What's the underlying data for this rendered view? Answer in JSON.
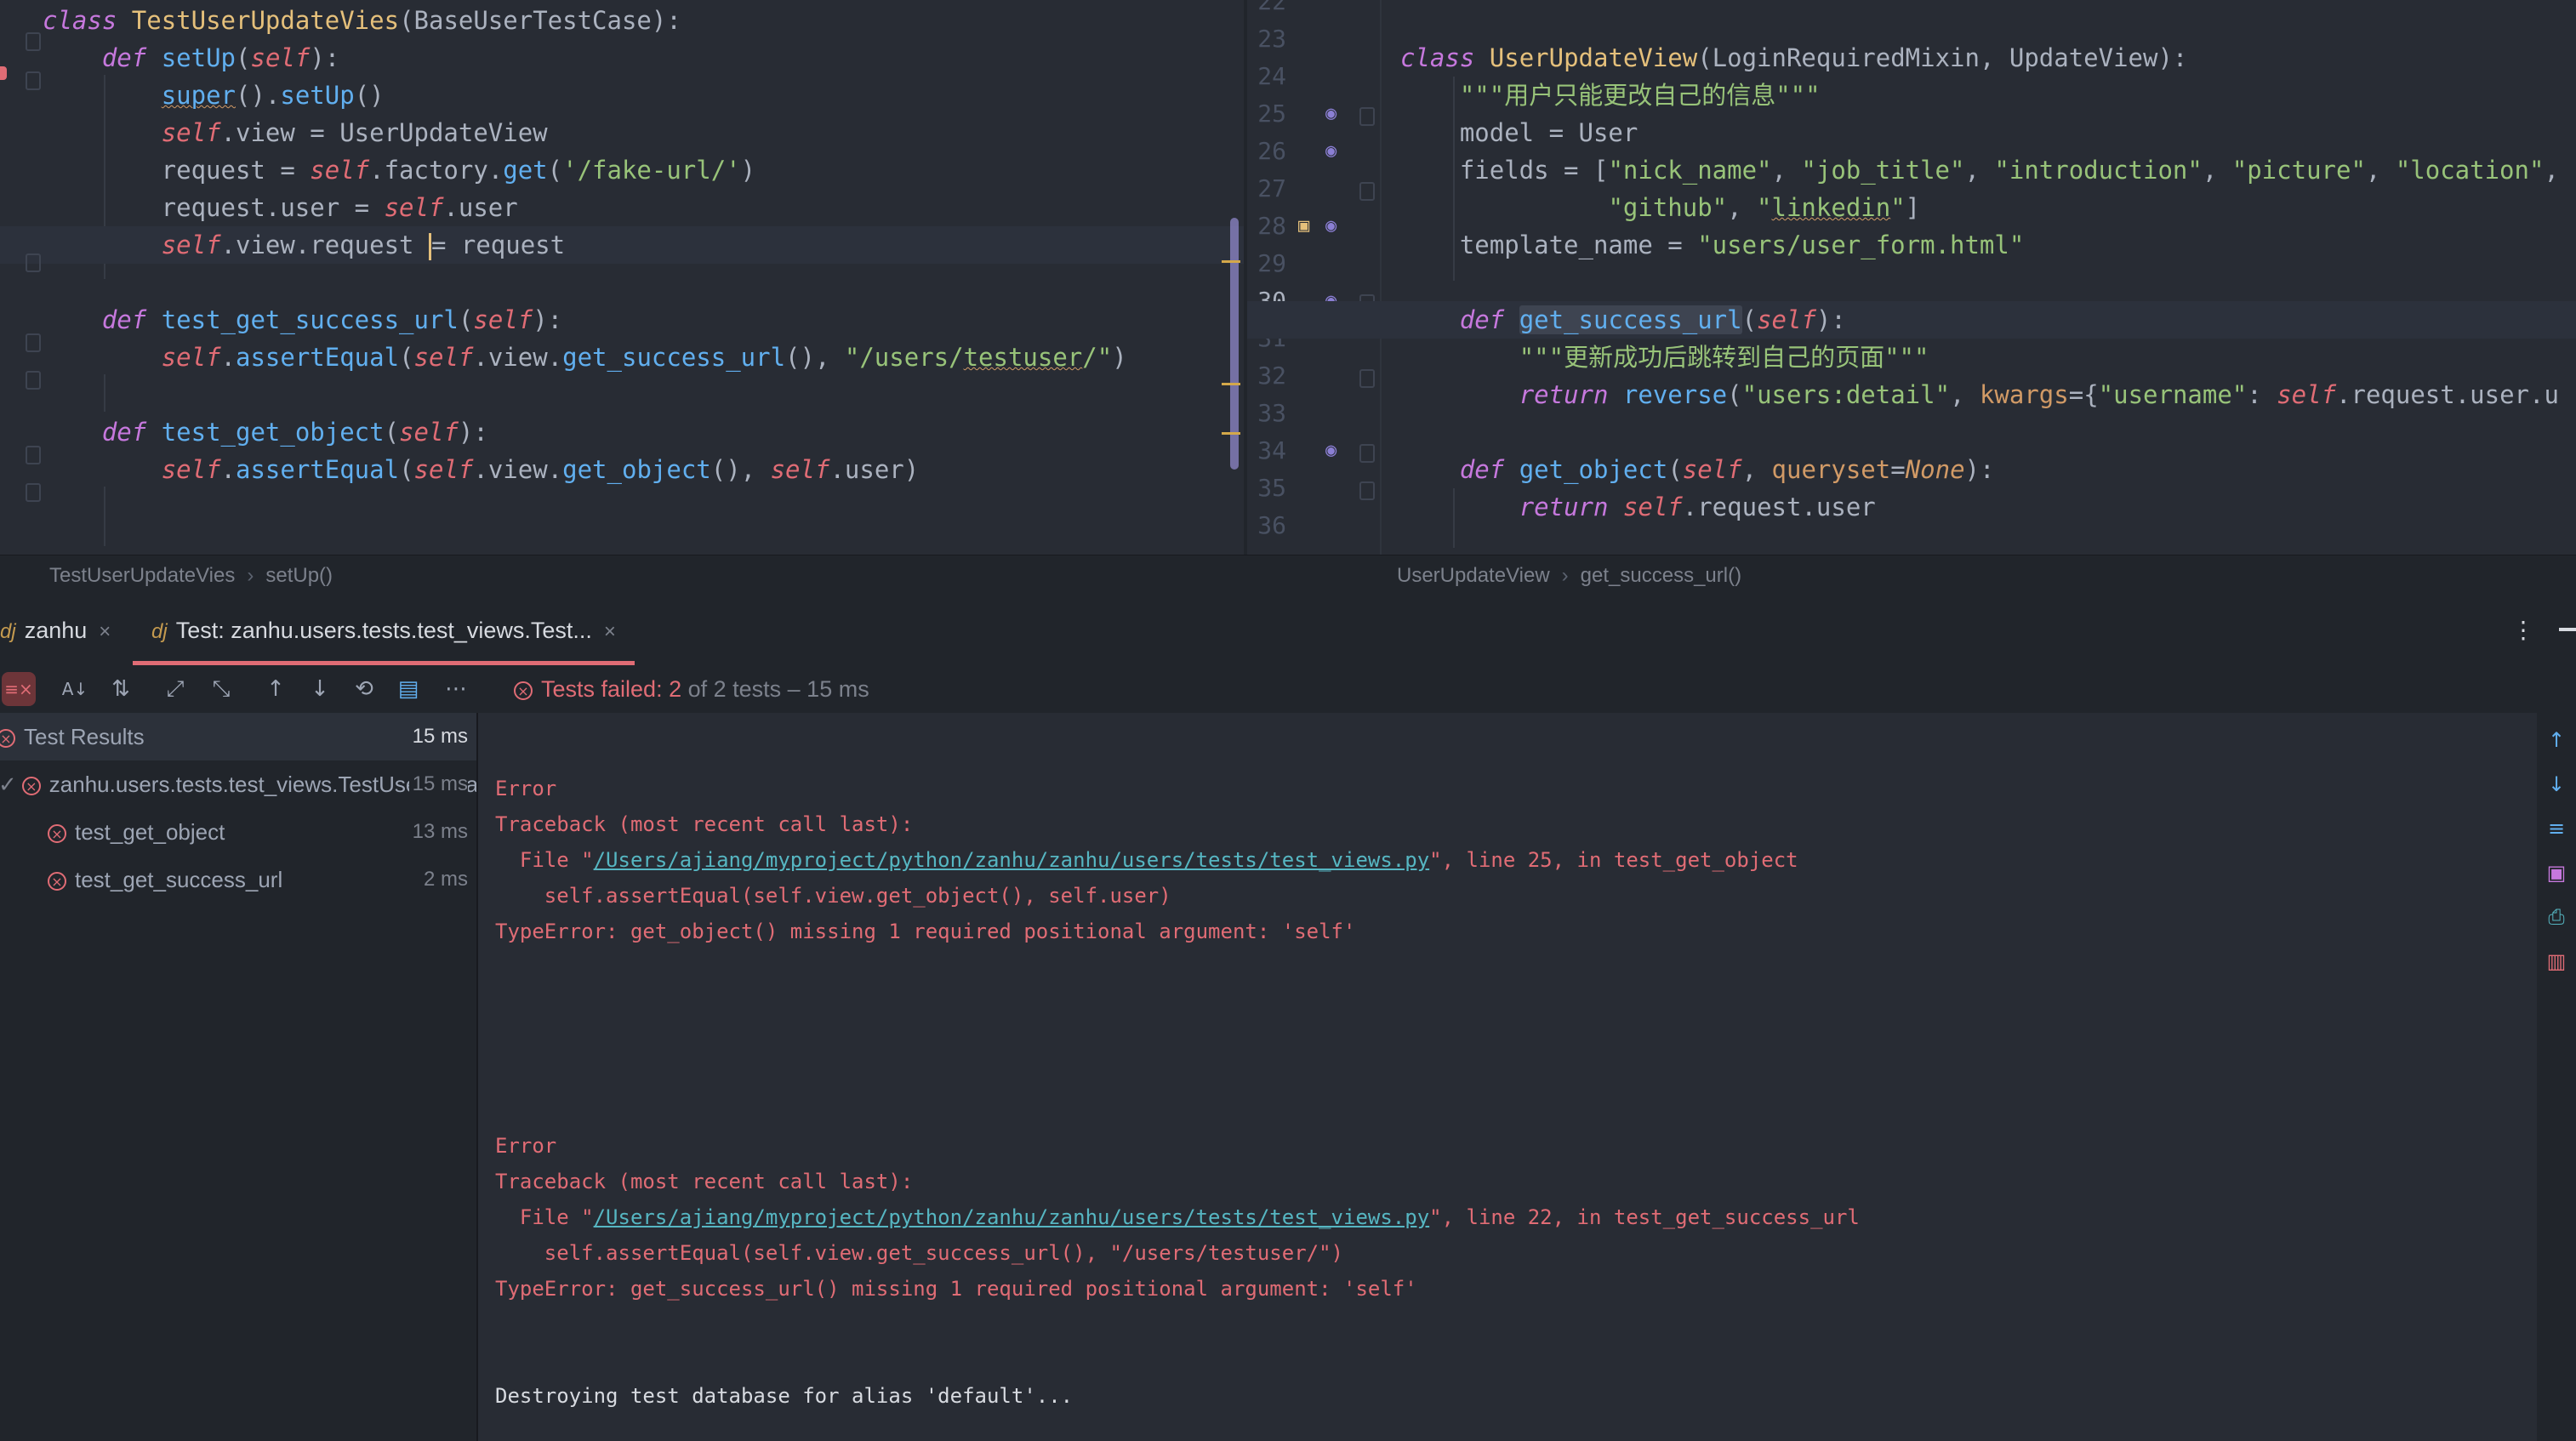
{
  "left_editor": {
    "lines": [
      [
        [
          "kw",
          "class"
        ],
        [
          "p",
          " "
        ],
        [
          "cls",
          "TestUserUpdateVies"
        ],
        [
          "p",
          "(BaseUserTestCase):"
        ]
      ],
      [
        [
          "p",
          "    "
        ],
        [
          "kw",
          "def"
        ],
        [
          "p",
          " "
        ],
        [
          "fn",
          "setUp"
        ],
        [
          "p",
          "("
        ],
        [
          "slf",
          "self"
        ],
        [
          "p",
          "):"
        ]
      ],
      [
        [
          "p",
          "        "
        ],
        [
          "fnsq",
          "super"
        ],
        [
          "p",
          "()."
        ],
        [
          "fn",
          "setUp"
        ],
        [
          "p",
          "()"
        ]
      ],
      [
        [
          "p",
          "        "
        ],
        [
          "slf",
          "self"
        ],
        [
          "p",
          ".view = UserUpdateView"
        ]
      ],
      [
        [
          "p",
          "        request = "
        ],
        [
          "slf",
          "self"
        ],
        [
          "p",
          ".factory."
        ],
        [
          "fn",
          "get"
        ],
        [
          "p",
          "("
        ],
        [
          "str",
          "'/fake-url/'"
        ],
        [
          "p",
          ")"
        ]
      ],
      [
        [
          "p",
          "        request.user = "
        ],
        [
          "slf",
          "self"
        ],
        [
          "p",
          ".user"
        ]
      ],
      [
        [
          "p",
          "        "
        ],
        [
          "slf",
          "self"
        ],
        [
          "p",
          ".view.request "
        ],
        [
          "cursor",
          ""
        ],
        [
          "p",
          "= request"
        ]
      ],
      [],
      [
        [
          "p",
          "    "
        ],
        [
          "kw",
          "def"
        ],
        [
          "p",
          " "
        ],
        [
          "fn",
          "test_get_success_url"
        ],
        [
          "p",
          "("
        ],
        [
          "slf",
          "self"
        ],
        [
          "p",
          "):"
        ]
      ],
      [
        [
          "p",
          "        "
        ],
        [
          "slf",
          "self"
        ],
        [
          "p",
          "."
        ],
        [
          "fn",
          "assertEqual"
        ],
        [
          "p",
          "("
        ],
        [
          "slf",
          "self"
        ],
        [
          "p",
          ".view."
        ],
        [
          "fn",
          "get_success_url"
        ],
        [
          "p",
          "(), "
        ],
        [
          "str",
          "\"/users/"
        ],
        [
          "strsq",
          "testuser"
        ],
        [
          "str",
          "/\""
        ],
        [
          "p",
          ")"
        ]
      ],
      [],
      [
        [
          "p",
          "    "
        ],
        [
          "kw",
          "def"
        ],
        [
          "p",
          " "
        ],
        [
          "fn",
          "test_get_object"
        ],
        [
          "p",
          "("
        ],
        [
          "slf",
          "self"
        ],
        [
          "p",
          "):"
        ]
      ],
      [
        [
          "p",
          "        "
        ],
        [
          "slf",
          "self"
        ],
        [
          "p",
          "."
        ],
        [
          "fn",
          "assertEqual"
        ],
        [
          "p",
          "("
        ],
        [
          "slf",
          "self"
        ],
        [
          "p",
          ".view."
        ],
        [
          "fn",
          "get_object"
        ],
        [
          "p",
          "(), "
        ],
        [
          "slf",
          "self"
        ],
        [
          "p",
          ".user)"
        ]
      ]
    ]
  },
  "right_editor": {
    "line_numbers": [
      "22",
      "23",
      "24",
      "25",
      "26",
      "27",
      "28",
      "29",
      "30",
      "31",
      "32",
      "33",
      "34",
      "35",
      "36"
    ],
    "active_line": "30",
    "lines": [
      [],
      [
        [
          "kw",
          "class"
        ],
        [
          "p",
          " "
        ],
        [
          "cls",
          "UserUpdateView"
        ],
        [
          "p",
          "(LoginRequiredMixin, UpdateView):"
        ]
      ],
      [
        [
          "p",
          "    "
        ],
        [
          "str",
          "\"\"\"用户只能更改自己的信息\"\"\""
        ]
      ],
      [
        [
          "p",
          "    model = User"
        ]
      ],
      [
        [
          "p",
          "    fields = ["
        ],
        [
          "str",
          "\"nick_name\""
        ],
        [
          "p",
          ", "
        ],
        [
          "str",
          "\"job_title\""
        ],
        [
          "p",
          ", "
        ],
        [
          "str",
          "\"introduction\""
        ],
        [
          "p",
          ", "
        ],
        [
          "str",
          "\"picture\""
        ],
        [
          "p",
          ", "
        ],
        [
          "str",
          "\"location\""
        ],
        [
          "p",
          ","
        ]
      ],
      [
        [
          "p",
          "              "
        ],
        [
          "str",
          "\"github\""
        ],
        [
          "p",
          ", "
        ],
        [
          "str",
          "\""
        ],
        [
          "strsq",
          "linkedin"
        ],
        [
          "str",
          "\""
        ],
        [
          "p",
          "]"
        ]
      ],
      [
        [
          "p",
          "    template_name = "
        ],
        [
          "str",
          "\"users/user_form.html\""
        ]
      ],
      [],
      [
        [
          "p",
          "    "
        ],
        [
          "kw",
          "def"
        ],
        [
          "p",
          " "
        ],
        [
          "fnsel",
          "get_success_url"
        ],
        [
          "p",
          "("
        ],
        [
          "slf",
          "self"
        ],
        [
          "p",
          "):"
        ]
      ],
      [
        [
          "p",
          "        "
        ],
        [
          "str",
          "\"\"\"更新成功后跳转到自己的页面\"\"\""
        ]
      ],
      [
        [
          "p",
          "        "
        ],
        [
          "kw",
          "return"
        ],
        [
          "p",
          " "
        ],
        [
          "fn",
          "reverse"
        ],
        [
          "p",
          "("
        ],
        [
          "str",
          "\"users:detail\""
        ],
        [
          "p",
          ", "
        ],
        [
          "nm",
          "kwargs"
        ],
        [
          "p",
          "={"
        ],
        [
          "str",
          "\"username\""
        ],
        [
          "p",
          ": "
        ],
        [
          "slf",
          "self"
        ],
        [
          "p",
          ".request.user.u"
        ]
      ],
      [],
      [
        [
          "p",
          "    "
        ],
        [
          "kw",
          "def"
        ],
        [
          "p",
          " "
        ],
        [
          "fn",
          "get_object"
        ],
        [
          "p",
          "("
        ],
        [
          "slf",
          "self"
        ],
        [
          "p",
          ", "
        ],
        [
          "nm",
          "queryset"
        ],
        [
          "p",
          "="
        ],
        [
          "none",
          "None"
        ],
        [
          "p",
          "):"
        ]
      ],
      [
        [
          "p",
          "        "
        ],
        [
          "kw",
          "return"
        ],
        [
          "p",
          " "
        ],
        [
          "slf",
          "self"
        ],
        [
          "p",
          ".request.user"
        ]
      ],
      []
    ]
  },
  "breadcrumbs": {
    "left": [
      "TestUserUpdateVies",
      "setUp()"
    ],
    "right": [
      "UserUpdateView",
      "get_success_url()"
    ]
  },
  "tool_tabs": [
    {
      "prefix": "dj",
      "label": "zanhu"
    },
    {
      "prefix": "dj",
      "label": "Test: zanhu.users.tests.test_views.Test..."
    }
  ],
  "toolbar": {
    "status_prefix": "Tests failed: ",
    "failed_count": "2",
    "status_suffix": " of 2 tests – 15 ms"
  },
  "test_tree": {
    "header": {
      "label": "Test Results",
      "time": "15 ms"
    },
    "rows": [
      {
        "label": "zanhu.users.tests.test_views.TestUserUpdateVies",
        "time": "15 ms"
      },
      {
        "label": "test_get_object",
        "time": "13 ms"
      },
      {
        "label": "test_get_success_url",
        "time": "2 ms"
      }
    ]
  },
  "console": {
    "blocks": [
      {
        "error": "Error",
        "traceback": "Traceback (most recent call last):",
        "file_prefix": "  File \"",
        "file_path": "/Users/ajiang/myproject/python/zanhu/zanhu/users/tests/test_views.py",
        "file_suffix": "\", line 25, in test_get_object",
        "code": "    self.assertEqual(self.view.get_object(), self.user)",
        "type_error": "TypeError: get_object() missing 1 required positional argument: 'self'"
      },
      {
        "error": "Error",
        "traceback": "Traceback (most recent call last):",
        "file_prefix": "  File \"",
        "file_path": "/Users/ajiang/myproject/python/zanhu/zanhu/users/tests/test_views.py",
        "file_suffix": "\", line 22, in test_get_success_url",
        "code": "    self.assertEqual(self.view.get_success_url(), \"/users/testuser/\")",
        "type_error": "TypeError: get_success_url() missing 1 required positional argument: 'self'"
      }
    ],
    "footer": "Destroying test database for alias 'default'..."
  }
}
